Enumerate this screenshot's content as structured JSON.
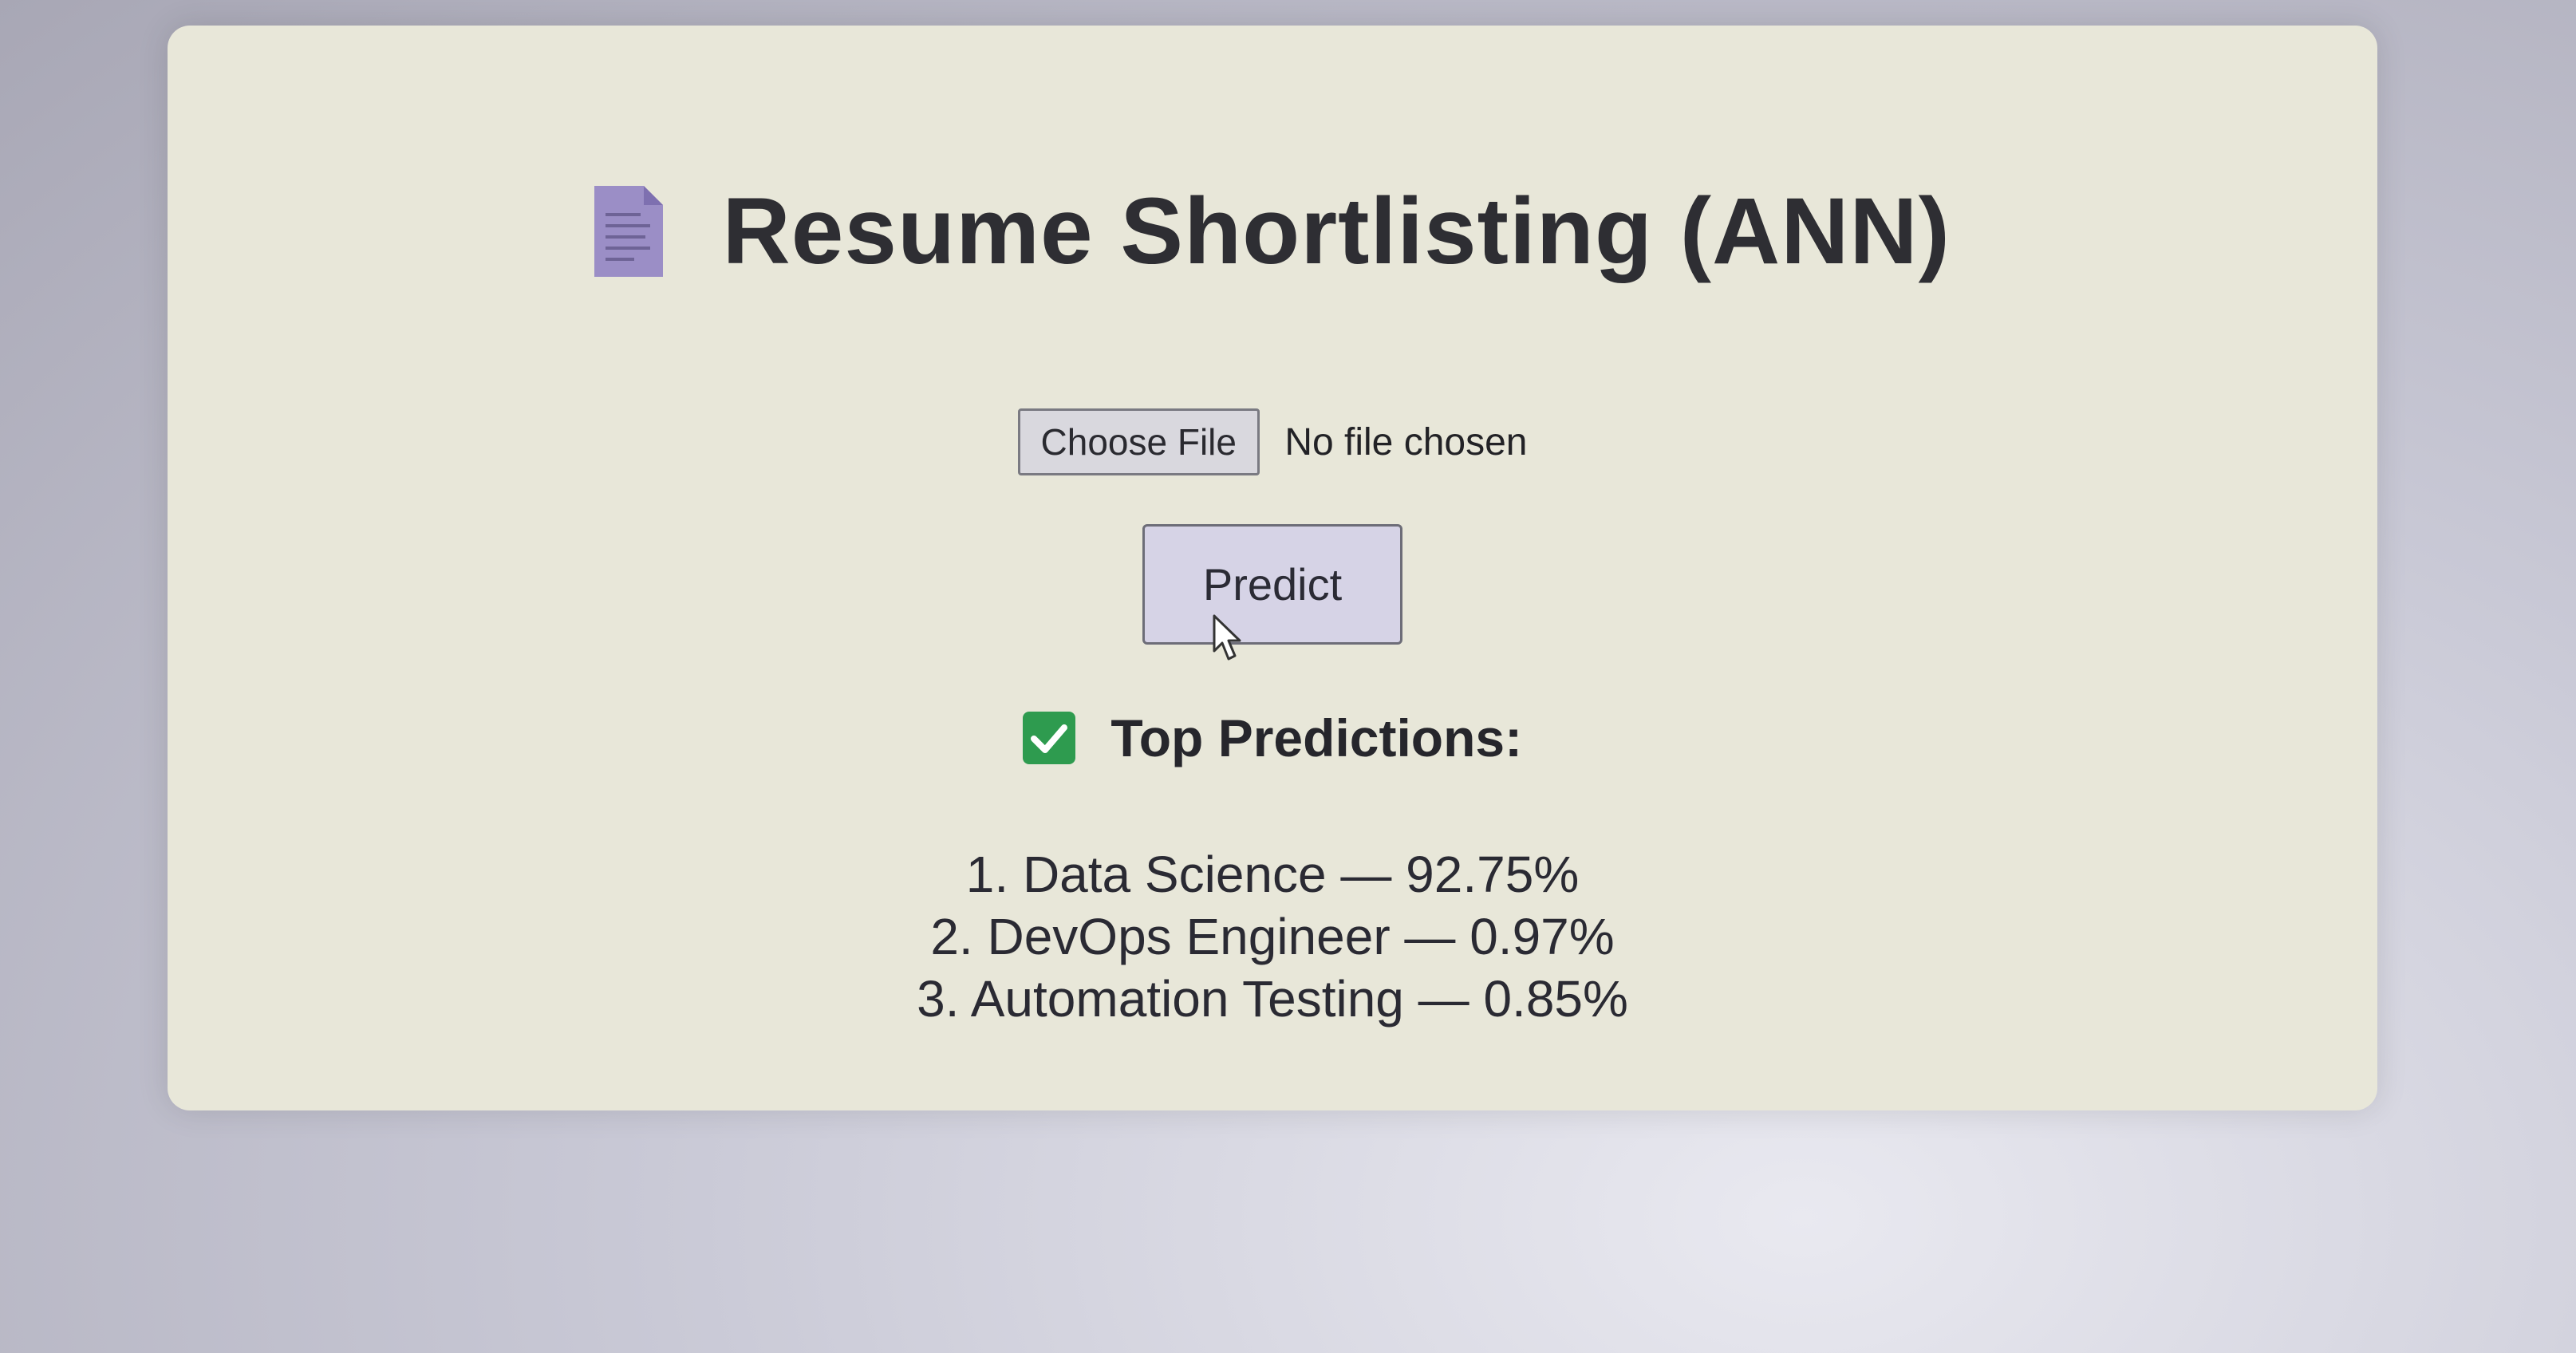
{
  "app": {
    "title": "Resume Shortlisting (ANN)",
    "title_icon": "document-icon"
  },
  "upload": {
    "button_label": "Choose File",
    "status_text": "No file chosen"
  },
  "actions": {
    "predict_label": "Predict"
  },
  "results": {
    "heading": "Top Predictions:",
    "heading_icon": "checkmark-icon",
    "items": [
      "1. Data Science — 92.75%",
      "2. DevOps Engineer — 0.97%",
      "3. Automation Testing — 0.85%"
    ]
  },
  "colors": {
    "card_background": "#e8e7d9",
    "check_green": "#2e9b4f",
    "doc_icon_purple": "#9b8ec6",
    "button_background": "#d6d3e6"
  }
}
